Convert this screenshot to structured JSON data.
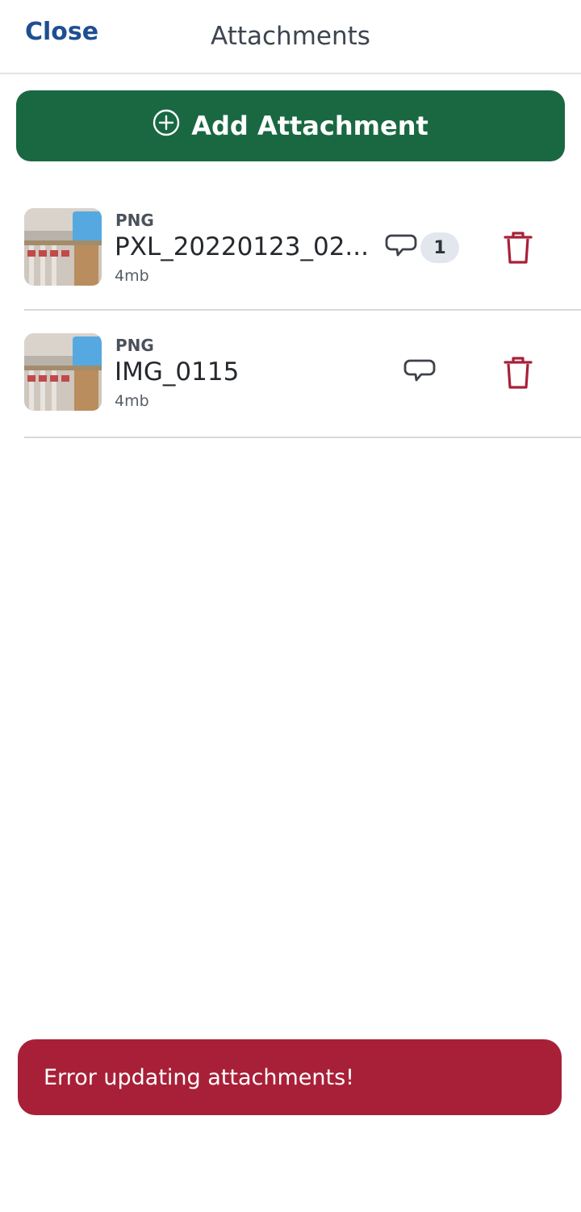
{
  "header": {
    "close_label": "Close",
    "title": "Attachments"
  },
  "add_button": {
    "label": "Add Attachment"
  },
  "attachments": [
    {
      "type": "PNG",
      "name": "PXL_20220123_02...",
      "size": "4mb",
      "comment_count": "1",
      "icon": "chat-bubble-icon"
    },
    {
      "type": "PNG",
      "name": "IMG_0115",
      "size": "4mb",
      "comment_count": "",
      "icon": "chat-bubble-icon"
    }
  ],
  "toast": {
    "message": "Error updating attachments!"
  },
  "colors": {
    "primary_green": "#196842",
    "link_blue": "#1f4f91",
    "danger_red": "#a82038"
  }
}
